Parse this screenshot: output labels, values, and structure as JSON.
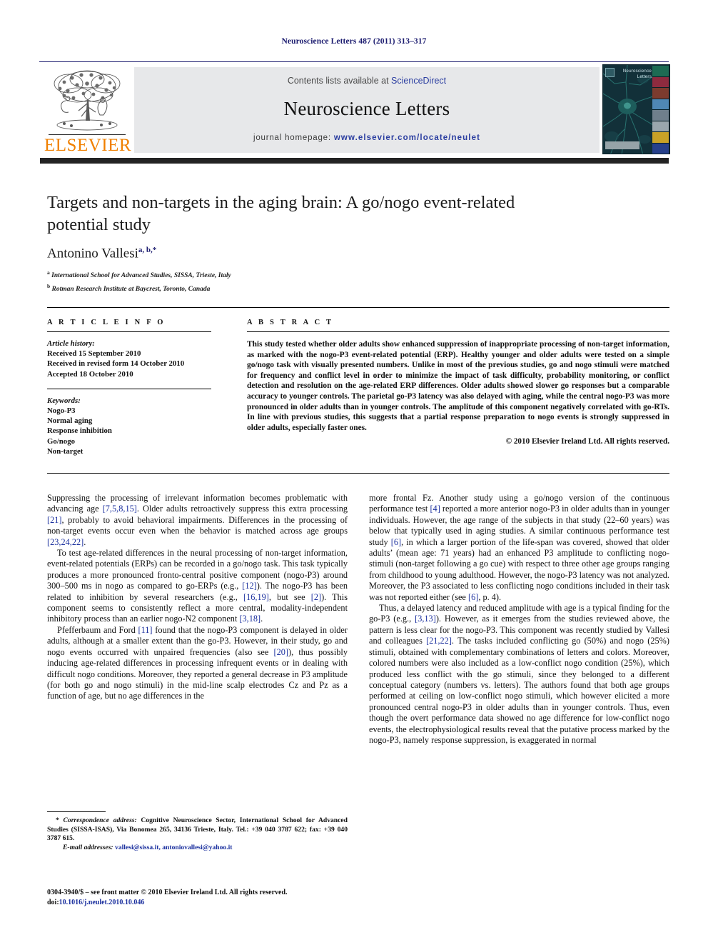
{
  "running_head": "Neuroscience Letters 487 (2011) 313–317",
  "header": {
    "contents_prefix": "Contents lists available at ",
    "sciencedirect": "ScienceDirect",
    "journal_title": "Neuroscience Letters",
    "homepage_label": "journal homepage:",
    "homepage_url": "www.elsevier.com/locate/neulet",
    "publisher_wordmark": "ELSEVIER",
    "cover_title": "Neuroscience Letters"
  },
  "article": {
    "title": "Targets and non-targets in the aging brain: A go/nogo event-related potential study",
    "author": "Antonino Vallesi",
    "author_marks": "a, b,*",
    "affiliations": [
      {
        "mark": "a",
        "text": "International School for Advanced Studies, SISSA, Trieste, Italy"
      },
      {
        "mark": "b",
        "text": "Rotman Research Institute at Baycrest, Toronto, Canada"
      }
    ]
  },
  "article_info": {
    "heading": "A R T I C L E   I N F O",
    "history_label": "Article history:",
    "history": [
      "Received 15 September 2010",
      "Received in revised form 14 October 2010",
      "Accepted 18 October 2010"
    ],
    "keywords_label": "Keywords:",
    "keywords": [
      "Nogo-P3",
      "Normal aging",
      "Response inhibition",
      "Go/nogo",
      "Non-target"
    ]
  },
  "abstract": {
    "heading": "A B S T R A C T",
    "text": "This study tested whether older adults show enhanced suppression of inappropriate processing of non-target information, as marked with the nogo-P3 event-related potential (ERP). Healthy younger and older adults were tested on a simple go/nogo task with visually presented numbers. Unlike in most of the previous studies, go and nogo stimuli were matched for frequency and conflict level in order to minimize the impact of task difficulty, probability monitoring, or conflict detection and resolution on the age-related ERP differences. Older adults showed slower go responses but a comparable accuracy to younger controls. The parietal go-P3 latency was also delayed with aging, while the central nogo-P3 was more pronounced in older adults than in younger controls. The amplitude of this component negatively correlated with go-RTs. In line with previous studies, this suggests that a partial response preparation to nogo events is strongly suppressed in older adults, especially faster ones.",
    "copyright": "© 2010 Elsevier Ireland Ltd. All rights reserved."
  },
  "body": {
    "left": {
      "p1": {
        "a": "Suppressing the processing of irrelevant information becomes problematic with advancing age ",
        "r1": "[7,5,8,15]",
        "b": ". Older adults retroactively suppress this extra processing ",
        "r2": "[21]",
        "c": ", probably to avoid behavioral impairments. Differences in the processing of non-target events occur even when the behavior is matched across age groups ",
        "r3": "[23,24,22]",
        "d": "."
      },
      "p2": {
        "a": "To test age-related differences in the neural processing of non-target information, event-related potentials (ERPs) can be recorded in a go/nogo task. This task typically produces a more pronounced fronto-central positive component (nogo-P3) around 300–500 ms in nogo as compared to go-ERPs (e.g., ",
        "r1": "[12]",
        "b": "). The nogo-P3 has been related to inhibition by several researchers (e.g., ",
        "r2": "[16,19]",
        "c": ", but see ",
        "r3": "[2]",
        "d": "). This component seems to consistently reflect a more central, modality-independent inhibitory process than an earlier nogo-N2 component ",
        "r4": "[3,18]",
        "e": "."
      },
      "p3": {
        "a": "Pfefferbaum and Ford ",
        "r1": "[11]",
        "b": " found that the nogo-P3 component is delayed in older adults, although at a smaller extent than the go-P3. However, in their study, go and nogo events occurred with unpaired frequencies (also see ",
        "r2": "[20]",
        "c": "), thus possibly inducing age-related differences in processing infrequent events or in dealing with difficult nogo conditions. Moreover, they reported a general decrease in P3 amplitude (for both go and nogo stimuli) in the mid-line scalp electrodes Cz and Pz as a function of age, but no age differences in the"
      }
    },
    "right": {
      "p1": {
        "a": "more frontal Fz. Another study using a go/nogo version of the continuous performance test ",
        "r1": "[4]",
        "b": " reported a more anterior nogo-P3 in older adults than in younger individuals. However, the age range of the subjects in that study (22–60 years) was below that typically used in aging studies. A similar continuous performance test study ",
        "r2": "[6]",
        "c": ", in which a larger portion of the life-span was covered, showed that older adults’ (mean age: 71 years) had an enhanced P3 amplitude to conflicting nogo-stimuli (non-target following a go cue) with respect to three other age groups ranging from childhood to young adulthood. However, the nogo-P3 latency was not analyzed. Moreover, the P3 associated to less conflicting nogo conditions included in their task was not reported either (see ",
        "r3": "[6]",
        "d": ", p. 4)."
      },
      "p2": {
        "a": "Thus, a delayed latency and reduced amplitude with age is a typical finding for the go-P3 (e.g., ",
        "r1": "[3,13]",
        "b": "). However, as it emerges from the studies reviewed above, the pattern is less clear for the nogo-P3. This component was recently studied by Vallesi and colleagues ",
        "r2": "[21,22]",
        "c": ". The tasks included conflicting go (50%) and nogo (25%) stimuli, obtained with complementary combinations of letters and colors. Moreover, colored numbers were also included as a low-conflict nogo condition (25%), which produced less conflict with the go stimuli, since they belonged to a different conceptual category (numbers vs. letters). The authors found that both age groups performed at ceiling on low-conflict nogo stimuli, which however elicited a more pronounced central nogo-P3 in older adults than in younger controls. Thus, even though the overt performance data showed no age difference for low-conflict nogo events, the electrophysiological results reveal that the putative process marked by the nogo-P3, namely response suppression, is exaggerated in normal"
      }
    }
  },
  "footnote": {
    "star": "*",
    "corr_label": "Correspondence address:",
    "corr_text": " Cognitive Neuroscience Sector, International School for Advanced Studies (SISSA-ISAS), Via Bonomea 265, 34136 Trieste, Italy. Tel.: +39 040 3787 622; fax: +39 040 3787 615.",
    "email_label": "E-mail addresses:",
    "emails": "vallesi@sissa.it, antoniovallesi@yahoo.it"
  },
  "frontmatter": {
    "line1": "0304-3940/$ – see front matter © 2010 Elsevier Ireland Ltd. All rights reserved.",
    "doi_label": "doi:",
    "doi": "10.1016/j.neulet.2010.10.046"
  },
  "colors": {
    "link_blue": "#1a2f9e",
    "elsevier_orange": "#F08000",
    "header_gray": "#e7e8ea",
    "rule_navy": "#1a1a6e"
  }
}
